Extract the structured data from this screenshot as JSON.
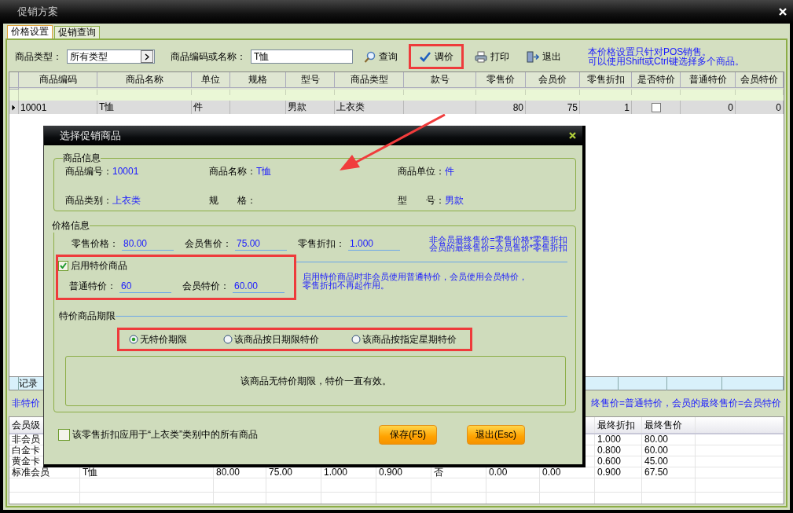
{
  "window": {
    "title": "促销方案"
  },
  "tabs": [
    {
      "label": "价格设置",
      "selected": true
    },
    {
      "label": "促销查询",
      "selected": false
    }
  ],
  "toolbar": {
    "category_label": "商品类型：",
    "category_value": "所有类型",
    "search_label": "商品编码或名称：",
    "search_value": "T恤",
    "buttons": [
      {
        "label": "查询",
        "kind": "search",
        "highlighted": false
      },
      {
        "label": "调价",
        "kind": "adjust",
        "highlighted": true
      },
      {
        "label": "打印",
        "kind": "print",
        "highlighted": false
      },
      {
        "label": "退出",
        "kind": "exit",
        "highlighted": false
      }
    ],
    "note": [
      "本价格设置只针对POS销售。",
      "可以使用Shift或Ctrl键选择多个商品。"
    ]
  },
  "grid": {
    "columns": [
      {
        "label": "商品编码",
        "kind": "text"
      },
      {
        "label": "商品名称",
        "kind": "text"
      },
      {
        "label": "单位",
        "kind": "text"
      },
      {
        "label": "规格",
        "kind": "text"
      },
      {
        "label": "型号",
        "kind": "text"
      },
      {
        "label": "商品类型",
        "kind": "text"
      },
      {
        "label": "款号",
        "kind": "text"
      },
      {
        "label": "零售价",
        "kind": "number"
      },
      {
        "label": "会员价",
        "kind": "number"
      },
      {
        "label": "零售折扣",
        "kind": "number"
      },
      {
        "label": "是否特价",
        "kind": "check"
      },
      {
        "label": "普通特价",
        "kind": "number"
      },
      {
        "label": "会员特价",
        "kind": "number"
      }
    ],
    "rows": [
      {
        "current": true,
        "special": false,
        "cells": [
          "10001",
          "T恤",
          "件",
          null,
          "男款",
          "上衣类",
          null,
          "80",
          "75",
          "1",
          null,
          "0",
          "0"
        ]
      }
    ]
  },
  "record_bar": {
    "label": "记录"
  },
  "notes": {
    "left": "非特价",
    "right": "终售价=普通特价，会员的最终售价=会员特价"
  },
  "member_table": {
    "columns": [
      "会员级",
      null,
      null,
      null,
      null,
      null,
      null,
      null,
      null,
      "最终折扣",
      "最终售价"
    ],
    "rows": [
      [
        "非会员",
        null,
        null,
        null,
        null,
        null,
        null,
        null,
        null,
        "1.000",
        "80.00"
      ],
      [
        "白金卡",
        null,
        null,
        null,
        null,
        null,
        null,
        null,
        null,
        "0.800",
        "60.00"
      ],
      [
        "黄金卡",
        null,
        null,
        null,
        null,
        null,
        null,
        null,
        null,
        "0.600",
        "45.00"
      ],
      [
        "标准会员",
        "T恤",
        "80.00",
        "75.00",
        "1.000",
        "0.900",
        "否",
        "0.00",
        "0.00",
        "0.900",
        "67.50"
      ]
    ]
  },
  "dialog": {
    "title": "选择促销商品",
    "product_group": {
      "title": "商品信息",
      "fields": [
        {
          "label": "商品编号：",
          "value": "10001"
        },
        {
          "label": "商品名称：",
          "value": "T恤"
        },
        {
          "label": "商品单位：",
          "value": "件"
        },
        {
          "label": "商品类别：",
          "value": "上衣类"
        },
        {
          "label": "规　　格："
        },
        {
          "label": "型　　号：",
          "value": "男款"
        }
      ]
    },
    "price_group": {
      "title": "价格信息",
      "prices": [
        {
          "label": "零售价格：",
          "value": "80.00"
        },
        {
          "label": "会员售价：",
          "value": "75.00"
        },
        {
          "label": "零售折扣：",
          "value": "1.000"
        }
      ],
      "formula_note": [
        "非会员最终售价=零售价格*零售折扣",
        "会员的最终售价=会员售价*零售折扣"
      ],
      "special_enabled": {
        "label": "启用特价商品",
        "checked": true
      },
      "special_prices": [
        {
          "label": "普通特价：",
          "value": "60"
        },
        {
          "label": "会员特价：",
          "value": "60.00"
        }
      ],
      "special_note": [
        "启用特价商品时非会员使用普通特价，会员使用会员特价，",
        "零售折扣不再起作用。"
      ],
      "period_title": "特价商品期限",
      "period_options": [
        {
          "label": "无特价期限",
          "selected": true
        },
        {
          "label": "该商品按日期限特价",
          "selected": false
        },
        {
          "label": "该商品按指定星期特价",
          "selected": false
        }
      ],
      "period_message": "该商品无特价期限，特价一直有效。"
    },
    "apply_all": {
      "label": "该零售折扣应用于“上衣类”类别中的所有商品",
      "checked": false
    },
    "buttons": [
      {
        "label": "保存(F5)"
      },
      {
        "label": "退出(Esc)"
      }
    ]
  }
}
